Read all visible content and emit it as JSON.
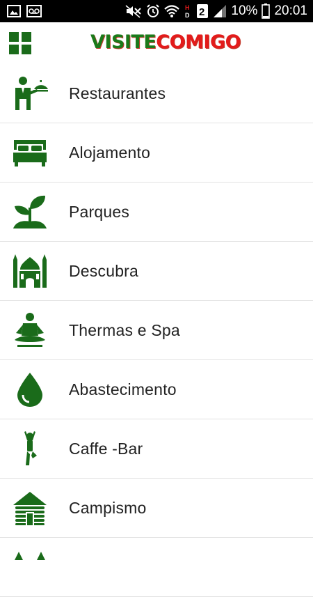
{
  "status_bar": {
    "battery_text": "10%",
    "time": "20:01",
    "icons": [
      "image-icon",
      "voicemail-icon",
      "mute-icon",
      "alarm-icon",
      "wifi-icon",
      "hd-icon",
      "sim-2-icon",
      "signal-icon",
      "battery-icon"
    ]
  },
  "app_bar": {
    "logo_part1": "VISITE",
    "logo_part2": "COMIGO",
    "menu_icon": "grid-menu-icon"
  },
  "colors": {
    "accent": "#1a6b1a",
    "logo_green": "#1a7a1a",
    "logo_red": "#e31b1b",
    "text": "#222222",
    "divider": "#e2e2e2"
  },
  "menu": {
    "items": [
      {
        "label": "Restaurantes",
        "icon": "waiter-icon"
      },
      {
        "label": "Alojamento",
        "icon": "bed-icon"
      },
      {
        "label": "Parques",
        "icon": "plant-icon"
      },
      {
        "label": "Descubra",
        "icon": "mosque-icon"
      },
      {
        "label": "Thermas e Spa",
        "icon": "meditation-icon"
      },
      {
        "label": "Abastecimento",
        "icon": "water-drop-icon"
      },
      {
        "label": "Caffe -Bar",
        "icon": "yoga-pose-icon"
      },
      {
        "label": "Campismo",
        "icon": "log-cabin-icon"
      }
    ]
  }
}
